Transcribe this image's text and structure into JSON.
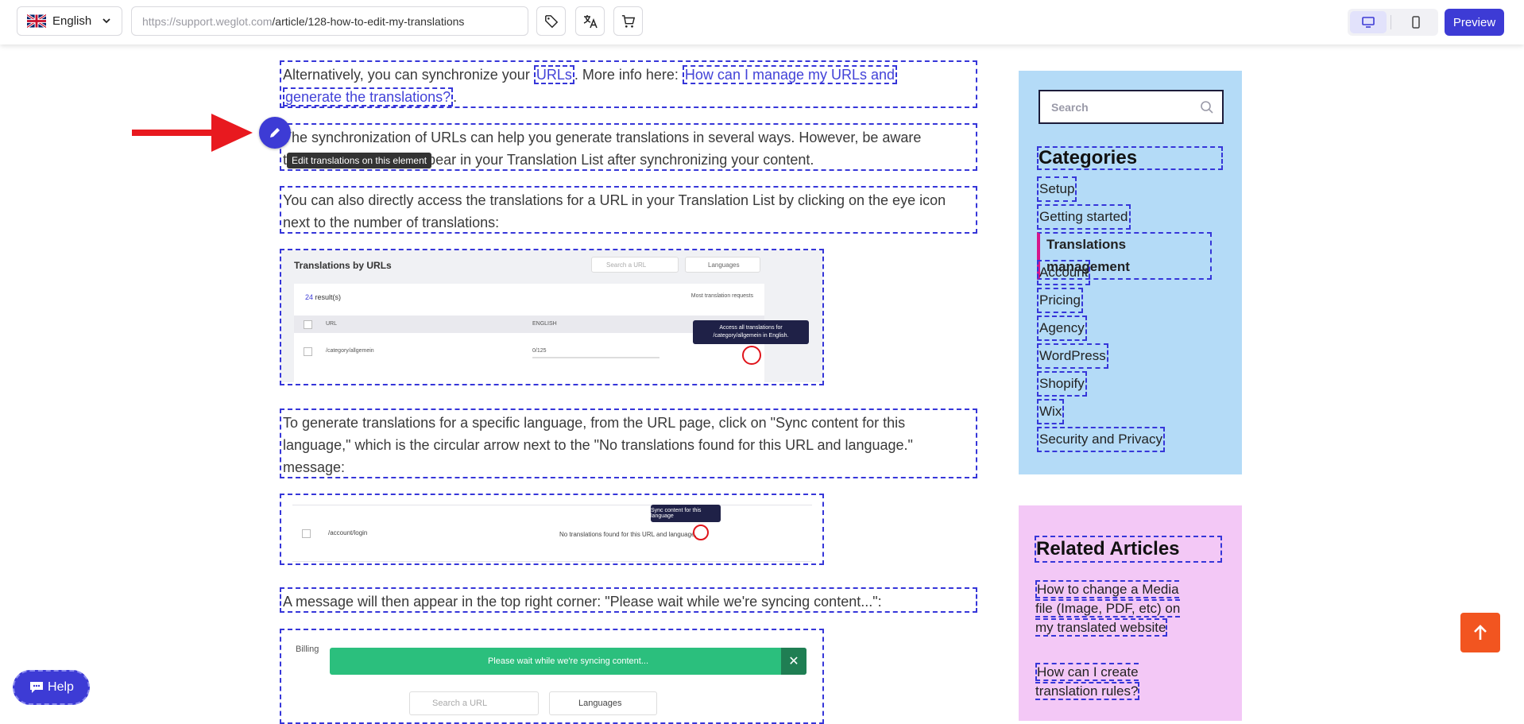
{
  "toolbar": {
    "language": "English",
    "url_host": "https://support.weglot.com",
    "url_path": "/article/128-how-to-edit-my-translations",
    "preview_label": "Preview"
  },
  "content": {
    "p1_text": "Alternatively, you can synchronize your ",
    "p1_link1": "URLs",
    "p1_mid": ". More info here: ",
    "p1_link2a": "How can I manage my URLs and",
    "p1_link2b": "generate the translations?",
    "p1_end": ".",
    "p2_line1": "The synchronization of URLs can help you generate translations in several ways. However, be aware",
    "p2_line2": "that translations will appear in your Translation List after synchronizing your content.",
    "p3": "You can also directly access the translations for a URL in your Translation List by clicking on the eye icon next to the number of translations:",
    "p4": "To generate translations for a specific language, from the URL page, click on \"Sync content for this language,\" which is the circular arrow next to the \"No translations found for this URL and language.\" message:",
    "p5": "A message will then appear in the top right corner: \"Please wait while we're syncing content...\":"
  },
  "shot1": {
    "title": "Translations by URLs",
    "search_placeholder": "Search a URL",
    "languages": "Languages",
    "results_count": "24",
    "results_label": " result(s)",
    "most_requests": "Most translation requests",
    "col_url": "URL",
    "col_english": "ENGLISH",
    "row_url": "/category/allgemein",
    "row_progress": "0/125",
    "tooltip_line1": "Access all translations for",
    "tooltip_line2": "/category/allgemein in English."
  },
  "shot2": {
    "row_url": "/account/login",
    "no_translations": "No translations found for this URL and language.",
    "tooltip": "Sync content for this language"
  },
  "shot3": {
    "billing": "Billing",
    "banner": "Please wait while we're syncing content...",
    "close": "✕",
    "search_placeholder": "Search a URL",
    "languages": "Languages"
  },
  "sidebar": {
    "search_placeholder": "Search",
    "categories_title": "Categories",
    "categories": [
      "Setup",
      "Getting started",
      "Translations management",
      "Account",
      "Pricing",
      "Agency",
      "WordPress",
      "Shopify",
      "Wix",
      "Security and Privacy"
    ],
    "related_title": "Related Articles",
    "related": [
      "How to change a Media file (Image, PDF, etc) on my translated website",
      "How can I create translation rules?"
    ]
  },
  "overlay": {
    "edit_tooltip": "Edit translations on this element",
    "help_label": "Help"
  },
  "colors": {
    "accent": "#3d3bd5",
    "categories_bg": "#b4dbf7",
    "related_bg": "#f3c8f6",
    "scroll_top": "#f25520",
    "active_marker": "#d7168a",
    "sync_banner": "#2bbf7d"
  }
}
